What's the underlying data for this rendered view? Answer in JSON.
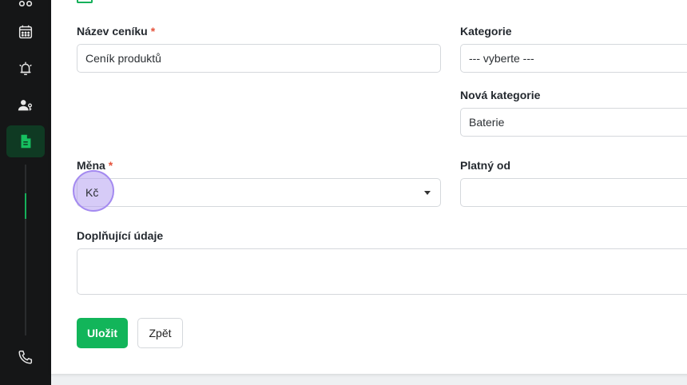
{
  "form": {
    "price_list_name_label": "Název ceníku",
    "price_list_name_value": "Ceník produktů",
    "required_mark": "*",
    "category_label": "Kategorie",
    "category_selected": "--- vyberte ---",
    "new_category_label": "Nová kategorie",
    "new_category_value": "Baterie",
    "currency_label": "Měna",
    "currency_value": "Kč",
    "valid_from_label": "Platný od",
    "valid_from_value": "",
    "additional_label": "Doplňující údaje",
    "additional_value": "",
    "save_label": "Uložit",
    "back_label": "Zpět"
  },
  "sidebar": {
    "items": [
      {
        "icon": "dashboard-icon"
      },
      {
        "icon": "calendar-icon"
      },
      {
        "icon": "alarm-icon"
      },
      {
        "icon": "user-key-icon"
      },
      {
        "icon": "document-icon",
        "active": true
      },
      {
        "icon": "phone-icon"
      }
    ]
  },
  "colors": {
    "accent": "#12b55a",
    "sidebar_bg": "#151617",
    "required": "#e5533c"
  }
}
